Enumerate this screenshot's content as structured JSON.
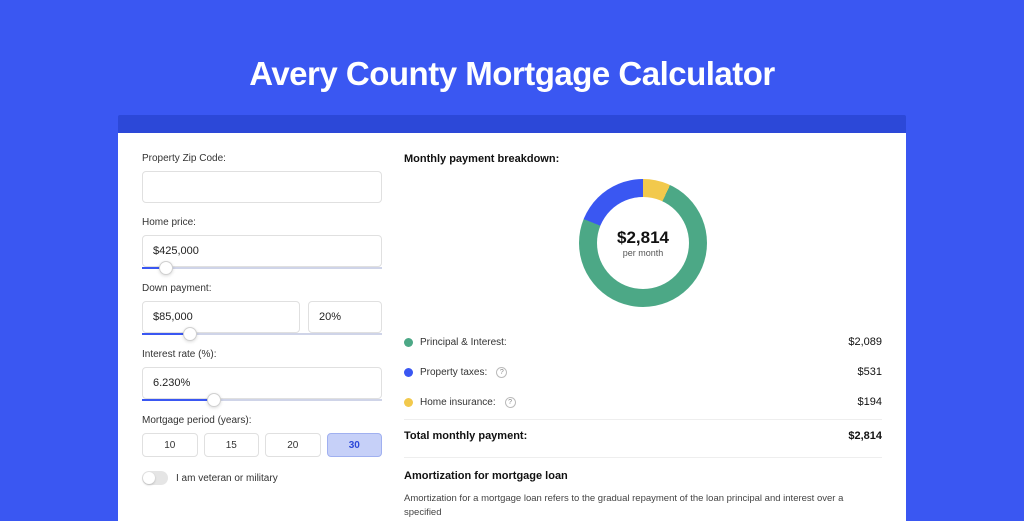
{
  "title": "Avery County Mortgage Calculator",
  "form": {
    "zip_label": "Property Zip Code:",
    "zip_value": "",
    "home_price_label": "Home price:",
    "home_price_value": "$425,000",
    "down_label": "Down payment:",
    "down_value": "$85,000",
    "down_pct": "20%",
    "rate_label": "Interest rate (%):",
    "rate_value": "6.230%",
    "period_label": "Mortgage period (years):",
    "periods": [
      "10",
      "15",
      "20",
      "30"
    ],
    "period_selected": "30",
    "veteran_label": "I am veteran or military"
  },
  "breakdown": {
    "title": "Monthly payment breakdown:",
    "center_value": "$2,814",
    "center_sub": "per month",
    "items": [
      {
        "label": "Principal & Interest:",
        "value": "$2,089",
        "color": "g"
      },
      {
        "label": "Property taxes:",
        "value": "$531",
        "color": "b",
        "info": true
      },
      {
        "label": "Home insurance:",
        "value": "$194",
        "color": "y",
        "info": true
      }
    ],
    "total_label": "Total monthly payment:",
    "total_value": "$2,814"
  },
  "amortization": {
    "title": "Amortization for mortgage loan",
    "text": "Amortization for a mortgage loan refers to the gradual repayment of the loan principal and interest over a specified"
  },
  "chart_data": {
    "type": "donut",
    "title": "Monthly payment breakdown",
    "series": [
      {
        "name": "Principal & Interest",
        "value": 2089,
        "color": "#4ca886"
      },
      {
        "name": "Property taxes",
        "value": 531,
        "color": "#3a57f2"
      },
      {
        "name": "Home insurance",
        "value": 194,
        "color": "#f2c94c"
      }
    ],
    "total": 2814,
    "center_label": "$2,814 per month"
  }
}
